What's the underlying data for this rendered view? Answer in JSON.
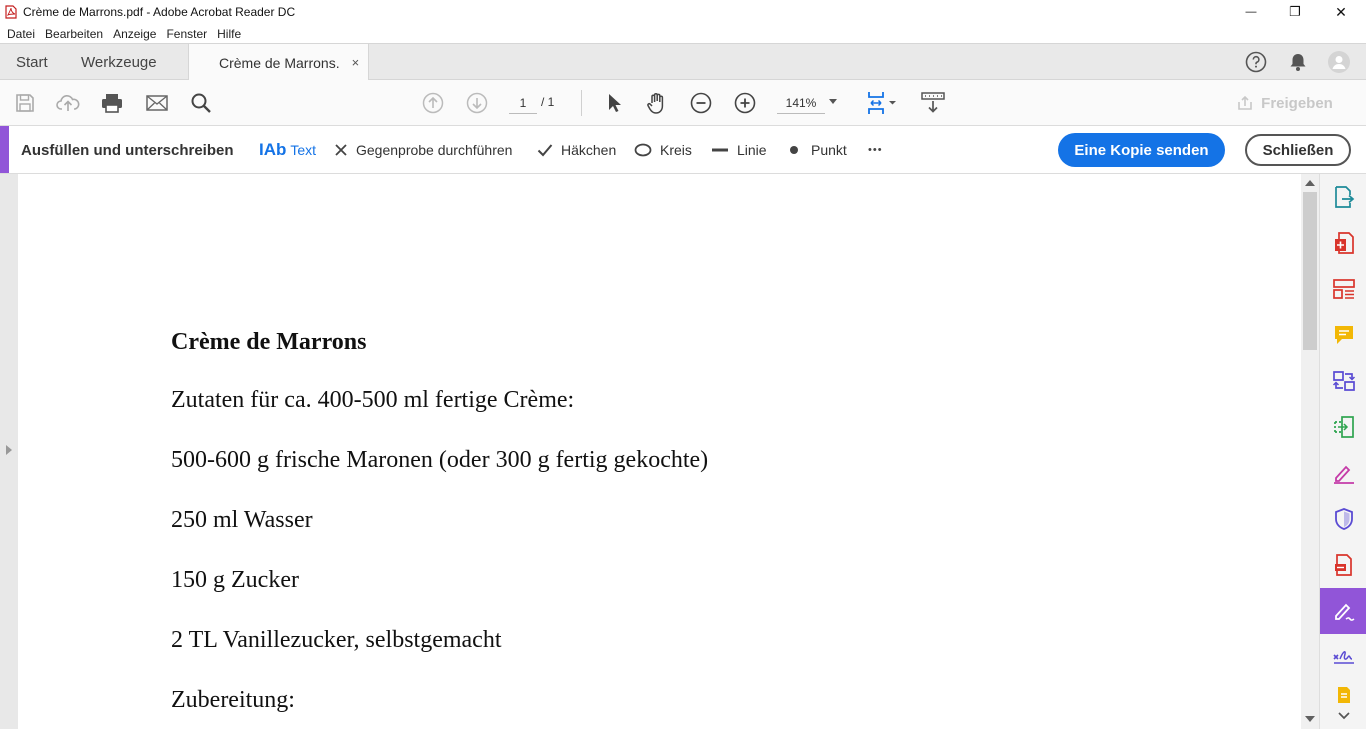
{
  "window": {
    "title": "Crème de Marrons.pdf - Adobe Acrobat Reader DC",
    "minimize": "—",
    "maximize": "❐",
    "close": "✕"
  },
  "menu": [
    "Datei",
    "Bearbeiten",
    "Anzeige",
    "Fenster",
    "Hilfe"
  ],
  "tabs": {
    "start": "Start",
    "tools": "Werkzeuge",
    "document": "Crème de Marrons.",
    "close": "×"
  },
  "toolbar": {
    "page_current": "1",
    "page_total": "/ 1",
    "zoom": "141%",
    "share": "Freigeben"
  },
  "fillsign": {
    "title": "Ausfüllen und unterschreiben",
    "text_tool": "Text",
    "text_icon": "IAb",
    "cross": "Gegenprobe durchführen",
    "check": "Häkchen",
    "circle": "Kreis",
    "line": "Linie",
    "dot": "Punkt",
    "more": "•••",
    "send_copy": "Eine Kopie senden",
    "close": "Schließen"
  },
  "document": {
    "lines": [
      "Crème de Marrons",
      "Zutaten für ca. 400-500 ml fertige Crème:",
      "500-600 g frische Maronen (oder 300 g fertig gekochte)",
      "250 ml Wasser",
      "150 g Zucker",
      "2 TL Vanillezucker, selbstgemacht",
      "Zubereitung:"
    ]
  },
  "colors": {
    "accent_purple": "#9155d8",
    "primary_blue": "#1473e6"
  },
  "right_panel_icons": [
    "export-pdf-icon",
    "create-pdf-icon",
    "organize-pages-icon",
    "comment-icon",
    "combine-files-icon",
    "compress-icon",
    "fill-sign-icon",
    "protect-icon",
    "pdf-convert-icon",
    "fill-sign-active-icon",
    "request-signature-icon",
    "more-tools-icon"
  ]
}
